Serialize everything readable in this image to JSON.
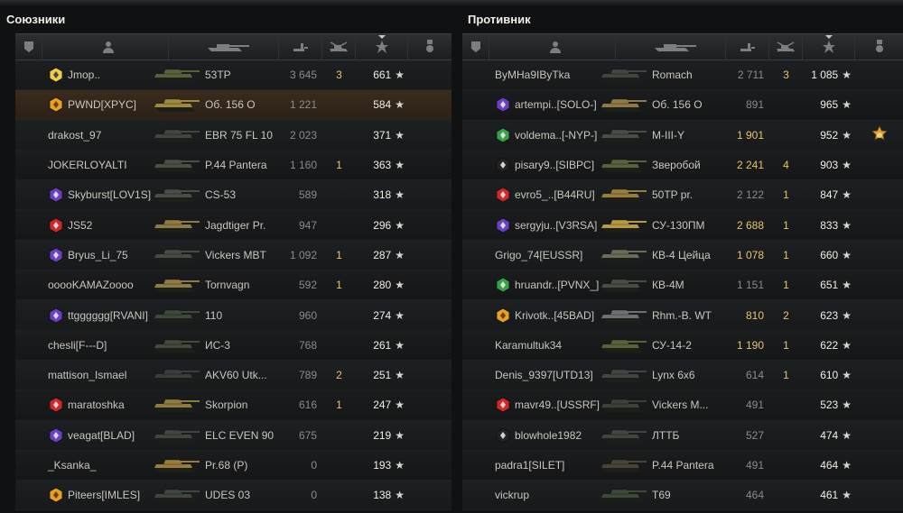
{
  "ally": {
    "title": "Союзники",
    "rows": [
      {
        "name": "Jmop..",
        "tank": "53TP",
        "damage": "3 645",
        "damage_hi": false,
        "kills": "3",
        "xp": "661",
        "badge": "yellow",
        "tank_color": "#59613c"
      },
      {
        "name": "PWND[XPYC]",
        "tank": "Об. 156 О",
        "damage": "1 221",
        "damage_hi": false,
        "kills": "",
        "xp": "584",
        "badge": "gold",
        "tank_color": "#a08a3a",
        "highlight": true
      },
      {
        "name": "drakost_97",
        "tank": "EBR 75 FL 10",
        "damage": "2 023",
        "damage_hi": false,
        "kills": "",
        "xp": "371",
        "badge": "",
        "tank_color": "#404640"
      },
      {
        "name": "JOKERLOYALTI",
        "tank": "P.44 Pantera",
        "damage": "1 160",
        "damage_hi": false,
        "kills": "1",
        "xp": "363",
        "badge": "",
        "tank_color": "#4c4f44"
      },
      {
        "name": "Skyburst[LOV1S]",
        "tank": "CS-53",
        "damage": "589",
        "damage_hi": false,
        "kills": "",
        "xp": "318",
        "badge": "purple",
        "tank_color": "#4a4c46"
      },
      {
        "name": "JS52",
        "tank": "Jagdtiger Pr.",
        "damage": "947",
        "damage_hi": false,
        "kills": "",
        "xp": "296",
        "badge": "red",
        "tank_color": "#8e7a42"
      },
      {
        "name": "Bryus_Li_75",
        "tank": "Vickers MBT",
        "damage": "1 092",
        "damage_hi": false,
        "kills": "1",
        "xp": "287",
        "badge": "purple",
        "tank_color": "#484b42"
      },
      {
        "name": "ooooKAMAZoooo",
        "tank": "Tornvagn",
        "damage": "592",
        "damage_hi": false,
        "kills": "1",
        "xp": "280",
        "badge": "",
        "tank_color": "#8e7a42"
      },
      {
        "name": "ttgggggg[RVANI]",
        "tank": "110",
        "damage": "960",
        "damage_hi": false,
        "kills": "",
        "xp": "274",
        "badge": "purple",
        "tank_color": "#3e4a38"
      },
      {
        "name": "chesli[F---D]",
        "tank": "ИС-3",
        "damage": "768",
        "damage_hi": false,
        "kills": "",
        "xp": "261",
        "badge": "",
        "tank_color": "#434a3c"
      },
      {
        "name": "mattison_Ismael",
        "tank": "AKV60 Utk...",
        "damage": "789",
        "damage_hi": false,
        "kills": "2",
        "xp": "251",
        "badge": "",
        "tank_color": "#3a3d38"
      },
      {
        "name": "maratoshka",
        "tank": "Skorpion",
        "damage": "616",
        "damage_hi": false,
        "kills": "1",
        "xp": "247",
        "badge": "red",
        "tank_color": "#8e7a42"
      },
      {
        "name": "veagat[BLAD]",
        "tank": "ELC EVEN 90",
        "damage": "675",
        "damage_hi": false,
        "kills": "",
        "xp": "219",
        "badge": "purple",
        "tank_color": "#404640"
      },
      {
        "name": "_Ksanka_",
        "tank": "Pr.68 (P)",
        "damage": "0",
        "damage_hi": false,
        "kills": "",
        "xp": "193",
        "badge": "",
        "tank_color": "#9a7e38"
      },
      {
        "name": "Piteers[IMLES]",
        "tank": "UDES 03",
        "damage": "0",
        "damage_hi": false,
        "kills": "",
        "xp": "138",
        "badge": "gold",
        "tank_color": "#404640"
      }
    ]
  },
  "enemy": {
    "title": "Противник",
    "rows": [
      {
        "name": "ByMHa9IByTka",
        "tank": "Romach",
        "damage": "2 711",
        "damage_hi": false,
        "kills": "3",
        "xp": "1 085",
        "badge": "",
        "tank_color": "#404640",
        "medal": false
      },
      {
        "name": "artempi..[SOLO-]",
        "tank": "Об. 156 О",
        "damage": "891",
        "damage_hi": false,
        "kills": "",
        "xp": "965",
        "badge": "purple",
        "tank_color": "#8e7a42",
        "medal": false
      },
      {
        "name": "voldema..[-NYP-]",
        "tank": "M-III-Y",
        "damage": "1 901",
        "damage_hi": true,
        "kills": "",
        "xp": "952",
        "badge": "green",
        "tank_color": "#4a4c46",
        "medal": true
      },
      {
        "name": "pisary9..[SIBPC]",
        "tank": "Зверобой",
        "damage": "2 241",
        "damage_hi": true,
        "kills": "4",
        "xp": "903",
        "badge": "dark",
        "tank_color": "#59613c",
        "medal": false
      },
      {
        "name": "evro5_..[B44RU]",
        "tank": "50TP pr.",
        "damage": "2 122",
        "damage_hi": false,
        "kills": "1",
        "xp": "847",
        "badge": "red",
        "tank_color": "#9a7e38",
        "medal": false
      },
      {
        "name": "sergyju..[V3RSA]",
        "tank": "СУ-130ПМ",
        "damage": "2 688",
        "damage_hi": true,
        "kills": "1",
        "xp": "833",
        "badge": "purple",
        "tank_color": "#b99a40",
        "medal": false
      },
      {
        "name": "Grigo_74[EUSSR]",
        "tank": "КВ-4 Цейца",
        "damage": "1 078",
        "damage_hi": true,
        "kills": "1",
        "xp": "660",
        "badge": "",
        "tank_color": "#6a6c56",
        "medal": false
      },
      {
        "name": "hruandr..[PVNX_]",
        "tank": "КВ-4М",
        "damage": "1 151",
        "damage_hi": false,
        "kills": "1",
        "xp": "651",
        "badge": "green",
        "tank_color": "#4a4c46",
        "medal": false
      },
      {
        "name": "Krivotk..[45BAD]",
        "tank": "Rhm.-B. WT",
        "damage": "810",
        "damage_hi": true,
        "kills": "2",
        "xp": "623",
        "badge": "gold",
        "tank_color": "#707070",
        "medal": false
      },
      {
        "name": "Karamultuk34",
        "tank": "СУ-14-2",
        "damage": "1 190",
        "damage_hi": true,
        "kills": "1",
        "xp": "622",
        "badge": "",
        "tank_color": "#59613c",
        "medal": false
      },
      {
        "name": "Denis_9397[UTD13]",
        "tank": "Lynx 6x6",
        "damage": "614",
        "damage_hi": false,
        "kills": "1",
        "xp": "610",
        "badge": "",
        "tank_color": "#404640",
        "medal": false
      },
      {
        "name": "mavr49..[USSRF]",
        "tank": "Vickers M...",
        "damage": "491",
        "damage_hi": false,
        "kills": "",
        "xp": "523",
        "badge": "red",
        "tank_color": "#3e4038",
        "medal": false
      },
      {
        "name": "blowhole1982",
        "tank": "ЛТТБ",
        "damage": "527",
        "damage_hi": false,
        "kills": "",
        "xp": "474",
        "badge": "dark",
        "tank_color": "#404640",
        "medal": false
      },
      {
        "name": "padra1[SILET]",
        "tank": "P.44 Pantera",
        "damage": "491",
        "damage_hi": false,
        "kills": "",
        "xp": "464",
        "badge": "",
        "tank_color": "#4a4438",
        "medal": false
      },
      {
        "name": "vickrup",
        "tank": "T69",
        "damage": "464",
        "damage_hi": false,
        "kills": "",
        "xp": "461",
        "badge": "",
        "tank_color": "#3e4a38",
        "medal": false
      }
    ]
  },
  "icons": {
    "platoon": "platoon-icon",
    "player": "player-icon",
    "tank": "tank-icon",
    "damage": "damage-icon",
    "kills": "kills-icon",
    "xp": "star-icon",
    "medal": "medal-icon"
  },
  "colors": {
    "gold_text": "#e8c46a",
    "highlight_row": "#3a2b1e"
  }
}
